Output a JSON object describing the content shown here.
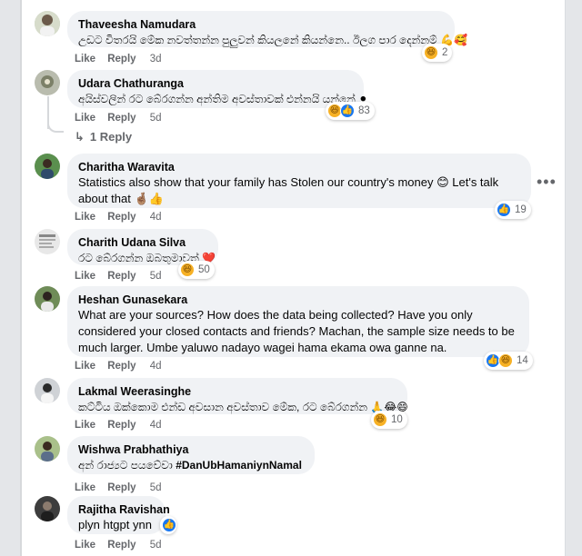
{
  "comments": [
    {
      "author": "Thaveesha Namudara",
      "text": "උඩට විතරයි මේක නවත්තන්න පුලුවන් කියලනේ කියන්නෙ.. ඊලග පාර දෙන්නම් 💪🥰",
      "actions": {
        "like": "Like",
        "reply": "Reply",
        "time": "3d"
      },
      "reaction_count": "2",
      "reaction_icons": [
        "haha-icon"
      ]
    },
    {
      "author": "Udara Chathuranga",
      "text": "අයිස්වලින් රට බේරගන්න අන්තිම අවස්තාවක් එන්නයි යන්නේ ⚫",
      "actions": {
        "like": "Like",
        "reply": "Reply",
        "time": "5d"
      },
      "reaction_count": "83",
      "reaction_icons": [
        "haha-icon",
        "like-icon",
        "love-icon"
      ],
      "replies_label": "1 Reply"
    },
    {
      "author": "Charitha Waravita",
      "text": "Statistics also show that your family has Stolen our country's money 😊 Let's talk about that 🤞🏽👍",
      "actions": {
        "like": "Like",
        "reply": "Reply",
        "time": "4d"
      },
      "reaction_count": "19",
      "reaction_icons": [
        "like-icon"
      ]
    },
    {
      "author": "Charith Udana Silva",
      "text": "රට බේරගන්න ඔබතුමාවත් ❤️",
      "actions": {
        "like": "Like",
        "reply": "Reply",
        "time": "5d"
      },
      "reaction_count": "50",
      "reaction_icons": [
        "haha-icon"
      ]
    },
    {
      "author": "Heshan Gunasekara",
      "text": "What are your sources? How does the data being collected? Have you only considered your closed contacts and friends? Machan, the sample size needs to be much larger. Umbe yaluwo nadayo wagei hama ekama owa ganne na.",
      "actions": {
        "like": "Like",
        "reply": "Reply",
        "time": "4d"
      },
      "reaction_count": "14",
      "reaction_icons": [
        "like-icon",
        "haha-icon"
      ]
    },
    {
      "author": "Lakmal Weerasinghe",
      "text": "කට්ටිය ඔක්කොම එන්ඩ අවසාන අවස්තාව මේක, රට බේරගන්න 🙏😂😄",
      "actions": {
        "like": "Like",
        "reply": "Reply",
        "time": "4d"
      },
      "reaction_count": "10",
      "reaction_icons": [
        "haha-icon"
      ]
    },
    {
      "author": "Wishwa Prabhathiya",
      "text": "අන් රාජ්‍යට පයවේවා",
      "hashtag": "#DanUbHamaniynNamal",
      "actions": {
        "like": "Like",
        "reply": "Reply",
        "time": "5d"
      }
    },
    {
      "author": "Rajitha Ravishan",
      "text": "plyn htgpt ynn",
      "actions": {
        "like": "Like",
        "reply": "Reply",
        "time": "5d"
      }
    }
  ],
  "icons": {
    "more": "more-options-icon",
    "reply_arrow": "reply-arrow-icon"
  },
  "colors": {
    "bubble": "#f0f2f5",
    "meta": "#65676b",
    "like_blue": "#1877f2",
    "haha_yellow": "#f7b125",
    "love_red": "#f33e58"
  }
}
